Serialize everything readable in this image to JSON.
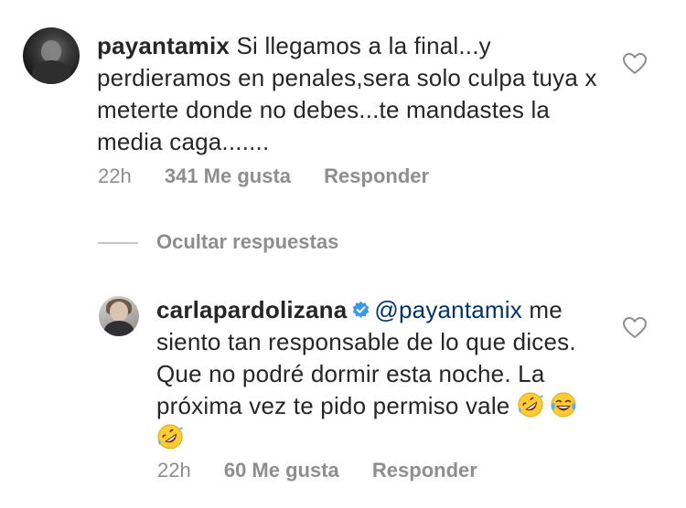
{
  "comments": [
    {
      "username": "payantamix",
      "text": "Si llegamos a la final...y perdieramos en penales,sera solo culpa tuya x meterte donde no debes...te mandastes la media caga.......",
      "time": "22h",
      "likes": "341 Me gusta",
      "reply_label": "Responder"
    }
  ],
  "hide_replies_label": "Ocultar respuestas",
  "replies": [
    {
      "username": "carlapardolizana",
      "verified": true,
      "mention": "@payantamix",
      "text": "me siento tan responsable de lo que dices. Que no podré dormir esta noche. La próxima vez te pido permiso vale",
      "emojis": [
        "rolling-on-floor-laughing-emoji",
        "tears-of-joy-emoji",
        "rolling-on-floor-laughing-emoji"
      ],
      "time": "22h",
      "likes": "60 Me gusta",
      "reply_label": "Responder"
    }
  ],
  "icons": {
    "like": "heart-outline-icon",
    "verified": "verified-badge-icon"
  },
  "colors": {
    "text": "#262626",
    "muted": "#8e8e8e",
    "mention": "#003569",
    "verified": "#3897f0"
  }
}
